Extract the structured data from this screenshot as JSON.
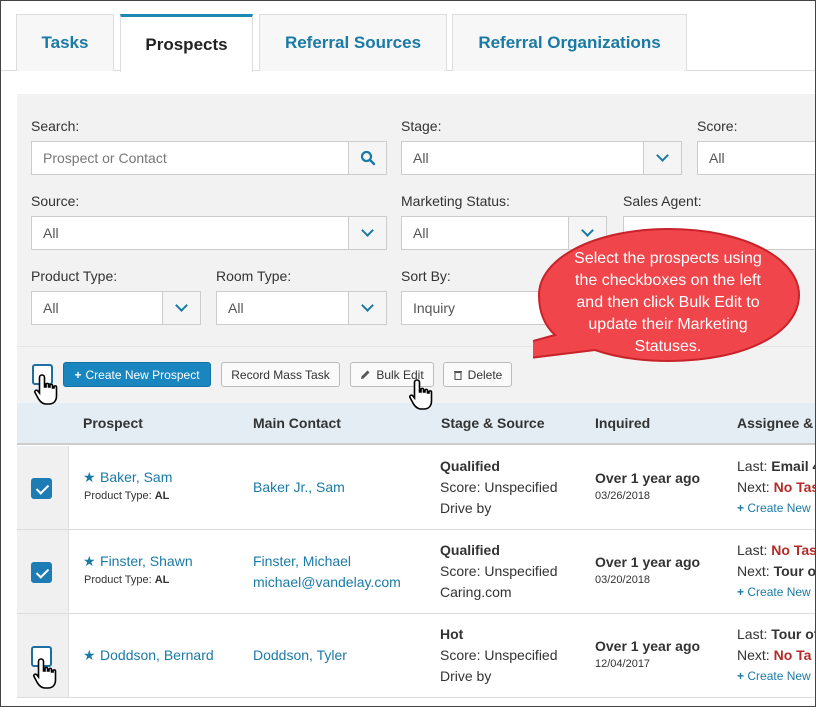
{
  "tabs": [
    {
      "label": "Tasks"
    },
    {
      "label": "Prospects"
    },
    {
      "label": "Referral Sources"
    },
    {
      "label": "Referral Organizations"
    }
  ],
  "filters": {
    "search_label": "Search:",
    "search_placeholder": "Prospect or Contact",
    "stage_label": "Stage:",
    "stage_value": "All",
    "score_label": "Score:",
    "score_value": "All",
    "source_label": "Source:",
    "source_value": "All",
    "marketing_label": "Marketing Status:",
    "marketing_value": "All",
    "sales_agent_label": "Sales Agent:",
    "product_type_label": "Product Type:",
    "product_type_value": "All",
    "room_type_label": "Room Type:",
    "room_type_value": "All",
    "sort_by_label": "Sort By:",
    "sort_by_value": "Inquiry"
  },
  "toolbar": {
    "create_label": "Create New Prospect",
    "mass_task_label": "Record Mass Task",
    "bulk_edit_label": "Bulk Edit",
    "delete_label": "Delete"
  },
  "callout": {
    "text": "Select the prospects using the checkboxes on the left and then click Bulk Edit to update their Marketing Statuses."
  },
  "table": {
    "headers": [
      "Prospect",
      "Main Contact",
      "Stage & Source",
      "Inquired",
      "Assignee &"
    ],
    "rows": [
      {
        "checked": true,
        "name": "Baker, Sam",
        "product_type_label": "Product Type:",
        "product_type": "AL",
        "contact": "Baker Jr., Sam",
        "contact_email": "",
        "stage": "Qualified",
        "score": "Score: Unspecified",
        "source": "Drive by",
        "inquired": "Over 1 year ago",
        "date": "03/26/2018",
        "last_label": "Last:",
        "last_value": "Email 4",
        "next_label": "Next:",
        "next_value": "No Tas",
        "create_task": "Create New"
      },
      {
        "checked": true,
        "name": "Finster, Shawn",
        "product_type_label": "Product Type:",
        "product_type": "AL",
        "contact": "Finster, Michael",
        "contact_email": "michael@vandelay.com",
        "stage": "Qualified",
        "score": "Score: Unspecified",
        "source": "Caring.com",
        "inquired": "Over 1 year ago",
        "date": "03/20/2018",
        "last_label": "Last:",
        "last_value": "No Tas",
        "next_label": "Next:",
        "next_value": "Tour o",
        "create_task": "Create New"
      },
      {
        "checked": false,
        "name": "Doddson, Bernard",
        "product_type_label": "",
        "product_type": "",
        "contact": "Doddson, Tyler",
        "contact_email": "",
        "stage": "Hot",
        "score": "Score: Unspecified",
        "source": "Drive by",
        "inquired": "Over 1 year ago",
        "date": "12/04/2017",
        "last_label": "Last:",
        "last_value": "Tour of",
        "next_label": "Next:",
        "next_value": "No Ta",
        "create_task": "Create New"
      }
    ]
  }
}
